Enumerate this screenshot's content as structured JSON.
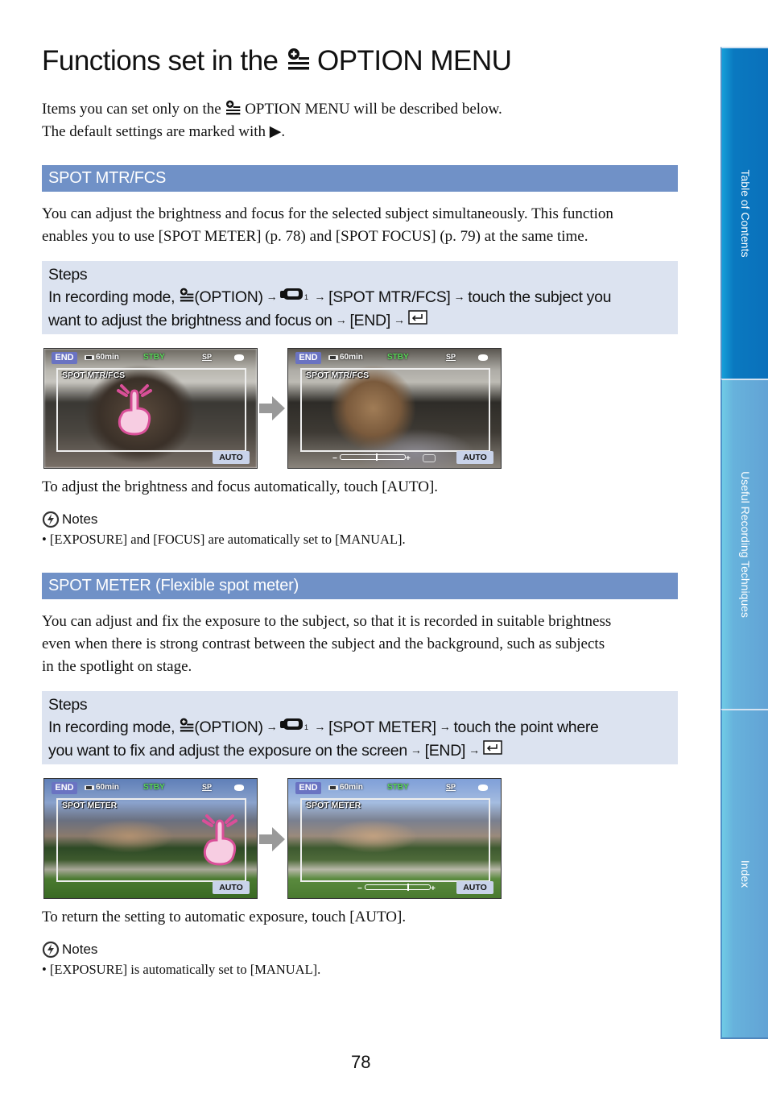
{
  "page": {
    "title_prefix": "Functions set in the",
    "title_suffix": "OPTION MENU",
    "intro_line1_prefix": "Items you can set only on the",
    "intro_line1_suffix": "OPTION MENU will be described below.",
    "intro_line2": "The default settings are marked with ▶.",
    "page_number": "78"
  },
  "icons": {
    "option": "option-menu-icon",
    "camera": "camera-mode-icon",
    "return": "return-icon",
    "arrow": "→",
    "notes": "notes-icon",
    "touch": "touch-hand-icon",
    "flow": "flow-arrow-icon"
  },
  "sections": [
    {
      "heading": "SPOT MTR/FCS",
      "description": [
        "You can adjust the brightness and focus for the selected subject simultaneously. This function",
        "enables you to use [SPOT METER] (p. 78) and [SPOT FOCUS] (p. 79) at the same time."
      ],
      "steps": {
        "title": "Steps",
        "l1_a": "In recording mode,",
        "l1_b": "(OPTION)",
        "l1_c": "[SPOT MTR/FCS]",
        "l1_d": "touch the subject you",
        "l2_a": "want to adjust the brightness and focus on",
        "l2_b": "[END]"
      },
      "screens": [
        {
          "end": "END",
          "time": "60min",
          "status": "STBY",
          "mode": "SP",
          "label": "SPOT MTR/FCS",
          "auto": "AUTO"
        },
        {
          "end": "END",
          "time": "60min",
          "status": "STBY",
          "mode": "SP",
          "label": "SPOT MTR/FCS",
          "auto": "AUTO",
          "slider_minus": "−",
          "slider_plus": "+",
          "slider_level": 0.55
        }
      ],
      "after_text": "To adjust the brightness and focus automatically, touch [AUTO].",
      "notes_title": "Notes",
      "notes": [
        "•  [EXPOSURE] and [FOCUS] are automatically set to [MANUAL]."
      ]
    },
    {
      "heading": "SPOT METER (Flexible spot meter)",
      "description": [
        "You can adjust and fix the exposure to the subject, so that it is recorded in suitable brightness",
        "even when there is strong contrast between the subject and the background, such as subjects",
        "in the spotlight on stage."
      ],
      "steps": {
        "title": "Steps",
        "l1_a": "In recording mode,",
        "l1_b": "(OPTION)",
        "l1_c": "[SPOT METER]",
        "l1_d": "touch the point where",
        "l2_a": "you want to fix and adjust the exposure on the screen",
        "l2_b": "[END]"
      },
      "screens": [
        {
          "end": "END",
          "time": "60min",
          "status": "STBY",
          "mode": "SP",
          "label": "SPOT METER",
          "auto": "AUTO"
        },
        {
          "end": "END",
          "time": "60min",
          "status": "STBY",
          "mode": "SP",
          "label": "SPOT METER",
          "auto": "AUTO",
          "slider_minus": "−",
          "slider_plus": "+",
          "slider_level": 0.65
        }
      ],
      "after_text": "To return the setting to automatic exposure, touch [AUTO].",
      "notes_title": "Notes",
      "notes": [
        "•  [EXPOSURE] is automatically set to [MANUAL]."
      ]
    }
  ],
  "side_tabs": [
    {
      "label": "Table of Contents",
      "active": true
    },
    {
      "label": "Useful Recording Techniques",
      "active": false
    },
    {
      "label": "Index",
      "active": false
    }
  ],
  "colors": {
    "section_bar": "#7091c7",
    "steps_box": "#dce3f0",
    "tab_active": "#0a79c0",
    "tab_inactive": "#67b2dc",
    "end_button": "#6a73c2",
    "auto_button": "#c9d3ea",
    "stby": "#58d858",
    "touch_pink": "#d94f98"
  }
}
